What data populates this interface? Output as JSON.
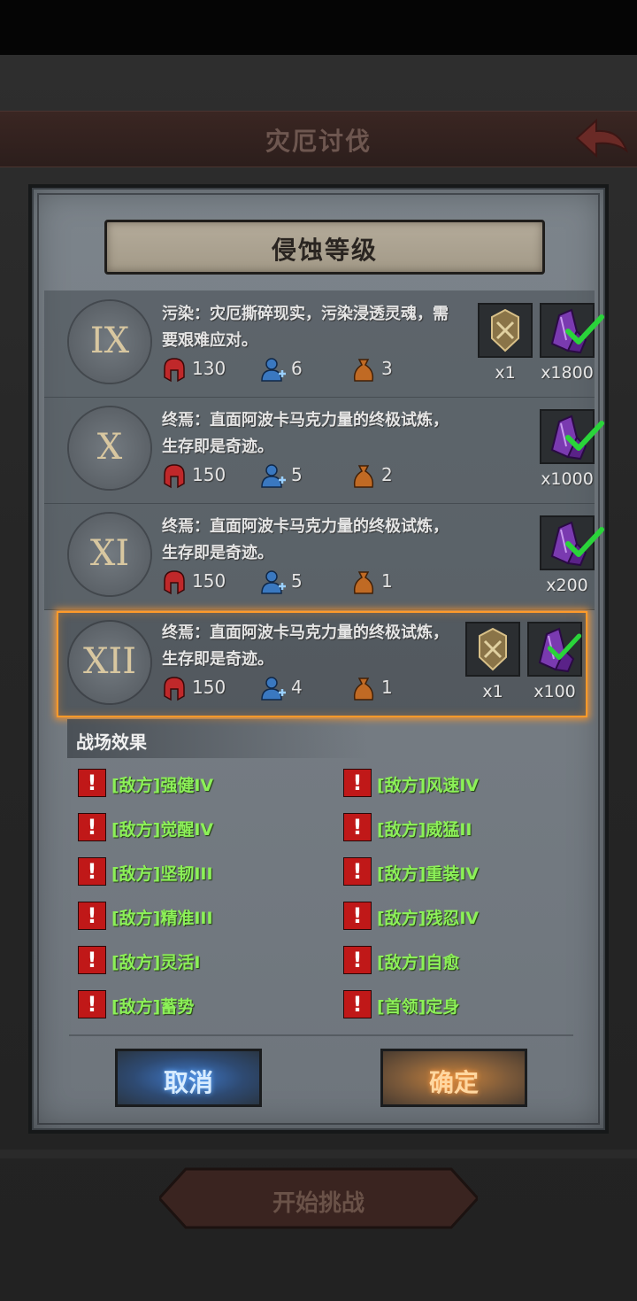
{
  "header": {
    "title": "灾厄讨伐"
  },
  "modal": {
    "title": "侵蚀等级",
    "levels": [
      {
        "numeral": "IX",
        "desc": "污染：灾厄撕碎现实，污染浸透灵魂，需要艰难应对。",
        "stat_red": "130",
        "stat_blue": "6",
        "stat_orange": "3",
        "rewards": [
          {
            "qty": "x1"
          },
          {
            "qty": "x1800"
          }
        ]
      },
      {
        "numeral": "X",
        "desc": "终焉：直面阿波卡马克力量的终极试炼，生存即是奇迹。",
        "stat_red": "150",
        "stat_blue": "5",
        "stat_orange": "2",
        "rewards": [
          {
            "qty": "x1000"
          }
        ]
      },
      {
        "numeral": "XI",
        "desc": "终焉：直面阿波卡马克力量的终极试炼，生存即是奇迹。",
        "stat_red": "150",
        "stat_blue": "5",
        "stat_orange": "1",
        "rewards": [
          {
            "qty": "x200"
          }
        ]
      },
      {
        "numeral": "XII",
        "desc": "终焉：直面阿波卡马克力量的终极试炼，生存即是奇迹。",
        "stat_red": "150",
        "stat_blue": "4",
        "stat_orange": "1",
        "rewards": [
          {
            "qty": "x1"
          },
          {
            "qty": "x100"
          }
        ]
      }
    ],
    "effects_title": "战场效果",
    "effects": [
      "[敌方]强健IV",
      "[敌方]风速IV",
      "[敌方]觉醒IV",
      "[敌方]威猛II",
      "[敌方]坚韧III",
      "[敌方]重装IV",
      "[敌方]精准III",
      "[敌方]残忍IV",
      "[敌方]灵活I",
      "[敌方]自愈",
      "[敌方]蓄势",
      "[首领]定身"
    ],
    "warn_glyph": "!",
    "cancel_label": "取消",
    "ok_label": "确定"
  },
  "footer": {
    "start_label": "开始挑战"
  },
  "colors": {
    "accent_selected": "#ff9a2a",
    "effect_text": "#8cf058",
    "warn_red": "#c01818"
  },
  "icons": {
    "stat_red": "helmet-icon",
    "stat_blue": "ally-add-icon",
    "stat_orange": "bag-icon",
    "reward_emblem": "emblem-icon",
    "reward_crystal": "purple-crystal-icon",
    "check": "check-icon"
  }
}
